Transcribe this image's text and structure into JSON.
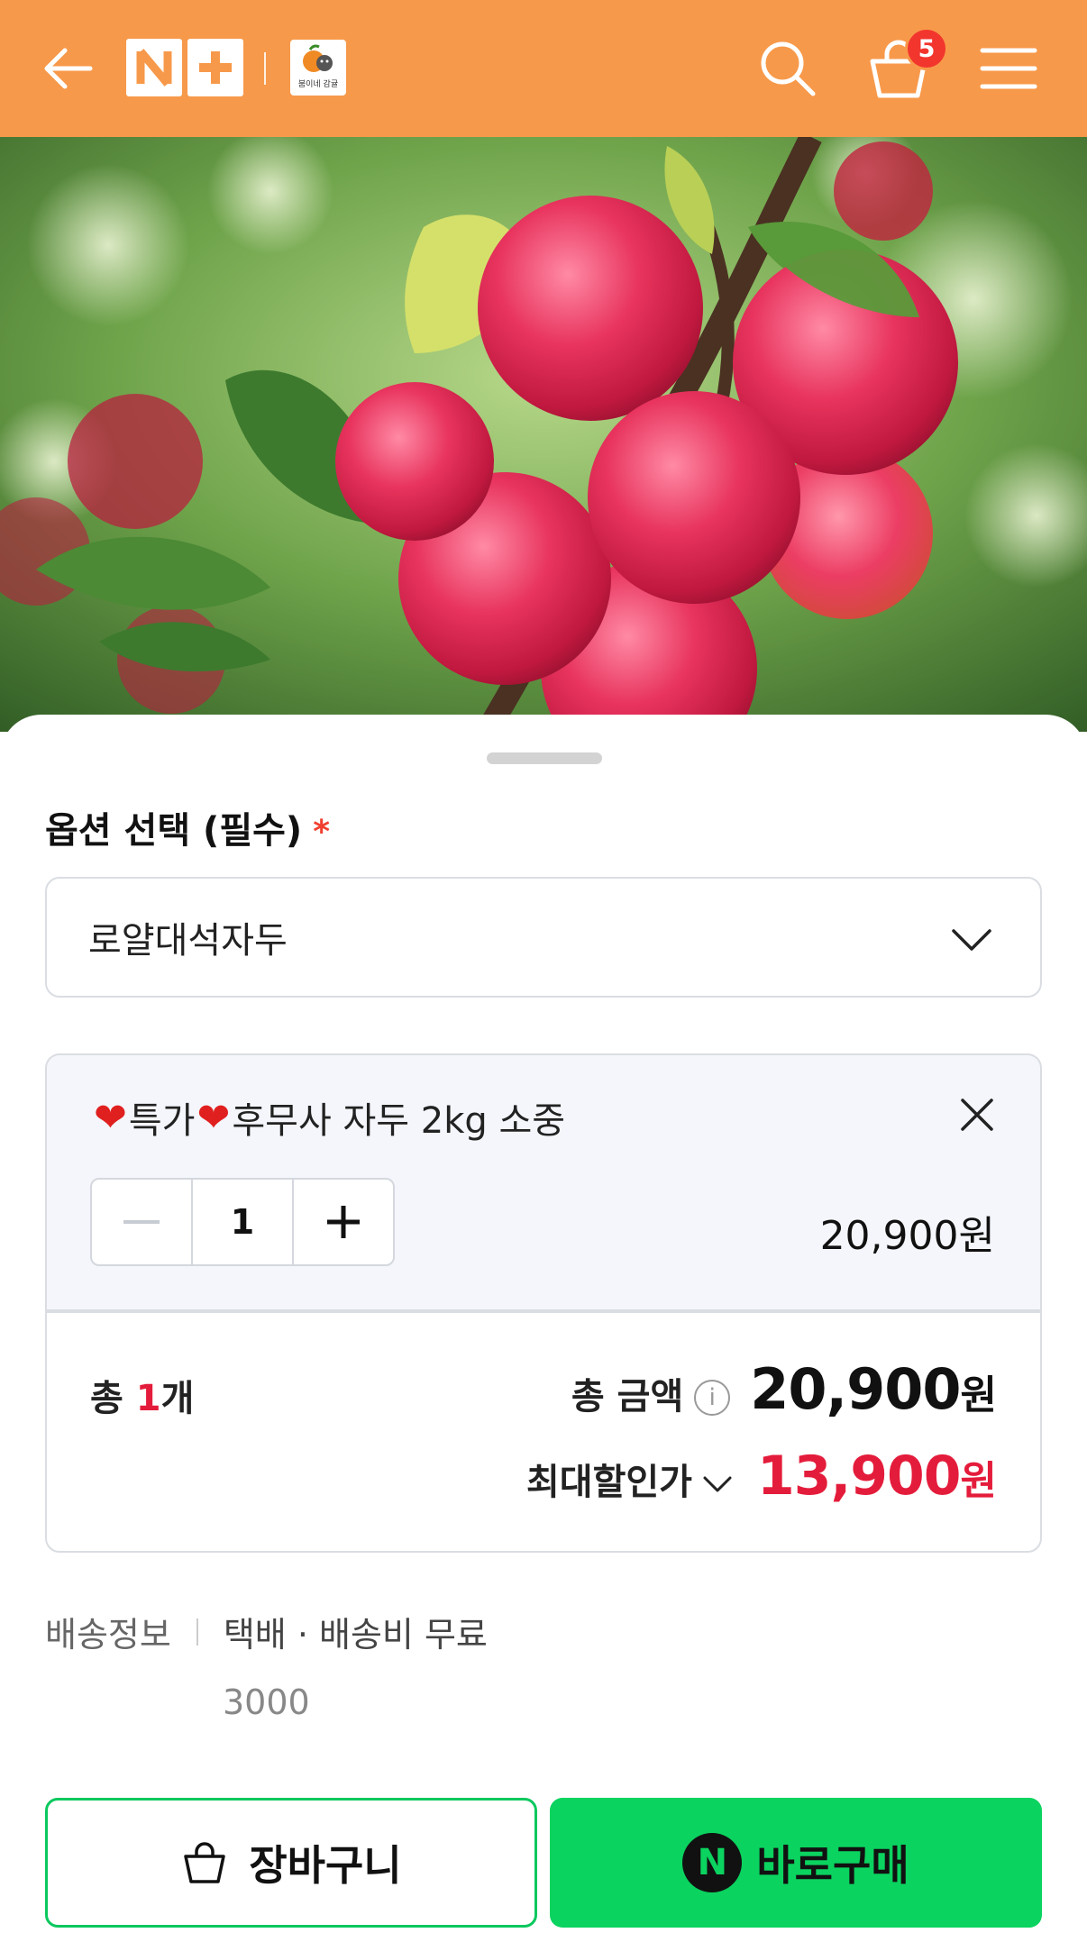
{
  "header": {
    "back_icon": "arrow-left-icon",
    "brand_logo_text": "N+",
    "shop_logo_text": "붐이네 감귤",
    "search_icon": "search-icon",
    "cart_icon": "shopping-bag-icon",
    "cart_count": "5",
    "menu_icon": "hamburger-menu-icon",
    "bg_color": "#F7994A"
  },
  "product_image": {
    "subject": "red plums on tree branch"
  },
  "option": {
    "title": "옵션 선택 (필수)",
    "required_mark": "*",
    "selected_value": "로얄대석자두"
  },
  "selected_item": {
    "name_part1": "특가",
    "name_part2": "후무사 자두 2kg 소중",
    "quantity": "1",
    "price": "20,900원"
  },
  "totals": {
    "count_prefix": "총 ",
    "count_value": "1",
    "count_suffix": "개",
    "amount_label": "총 금액",
    "amount_value": "20,900",
    "amount_unit": "원",
    "max_discount_label": "최대할인가",
    "max_discount_value": "13,900",
    "max_discount_unit": "원",
    "accent_color": "#E41C3B"
  },
  "shipping": {
    "label": "배송정보",
    "desc": "택배 · 배송비 무료",
    "extra": "3000"
  },
  "actions": {
    "cart_label": "장바구니",
    "buy_label": "바로구매",
    "buy_badge": "N",
    "buy_color": "#0BD35F"
  }
}
